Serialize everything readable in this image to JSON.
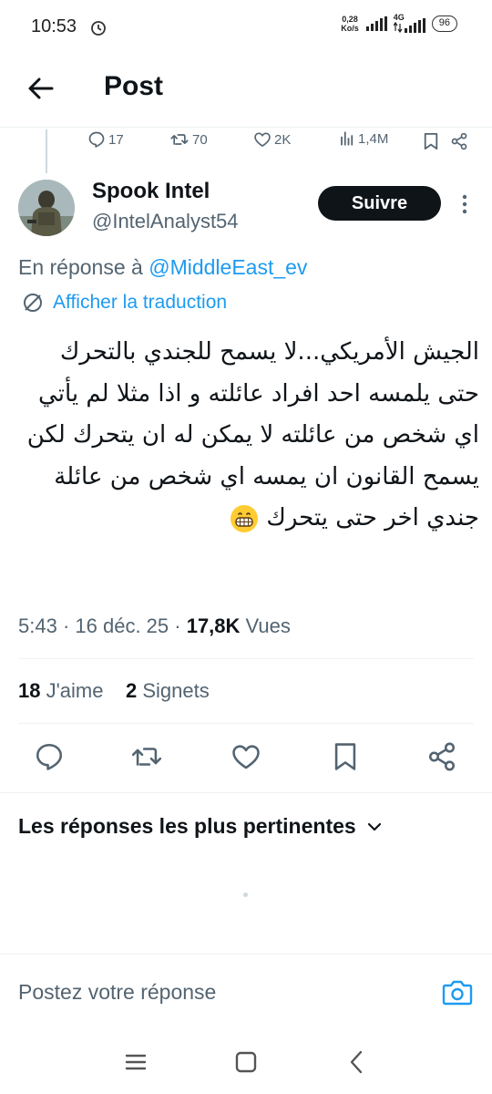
{
  "status_bar": {
    "time": "10:53",
    "net_speed_value": "0,28",
    "net_speed_unit": "Ko/s",
    "network": "4G",
    "battery": "96"
  },
  "header": {
    "title": "Post"
  },
  "previous_tweet_actions": {
    "replies": "17",
    "reposts": "70",
    "likes": "2K",
    "views": "1,4M"
  },
  "author": {
    "name": "Spook Intel",
    "handle": "@IntelAnalyst54",
    "follow_label": "Suivre"
  },
  "reply_context": {
    "prefix": "En réponse à ",
    "mention": "@MiddleEast_ev"
  },
  "translate_label": "Afficher la traduction",
  "tweet": {
    "lines": [
      "الجيش الأمريكي...لا يسمح للجندي بالتحرك",
      "حتى يلمسه احد افراد عائلته و اذا مثلا لم يأتي",
      "اي شخص من عائلته لا يمكن له ان يتحرك لكن",
      "يسمح القانون ان يمسه اي شخص من عائلة",
      "جندي اخر حتى يتحرك"
    ]
  },
  "meta": {
    "time": "5:43",
    "date": "16 déc. 25",
    "views_count": "17,8K",
    "views_label": "Vues"
  },
  "stats": {
    "likes_count": "18",
    "likes_label": "J'aime",
    "bookmarks_count": "2",
    "bookmarks_label": "Signets"
  },
  "sort": {
    "label": "Les réponses les plus pertinentes"
  },
  "composer": {
    "placeholder": "Postez votre réponse"
  },
  "colors": {
    "accent": "#1d9bf0",
    "text": "#0f1419",
    "secondary": "#536471",
    "follow_bg": "#0f1419"
  }
}
